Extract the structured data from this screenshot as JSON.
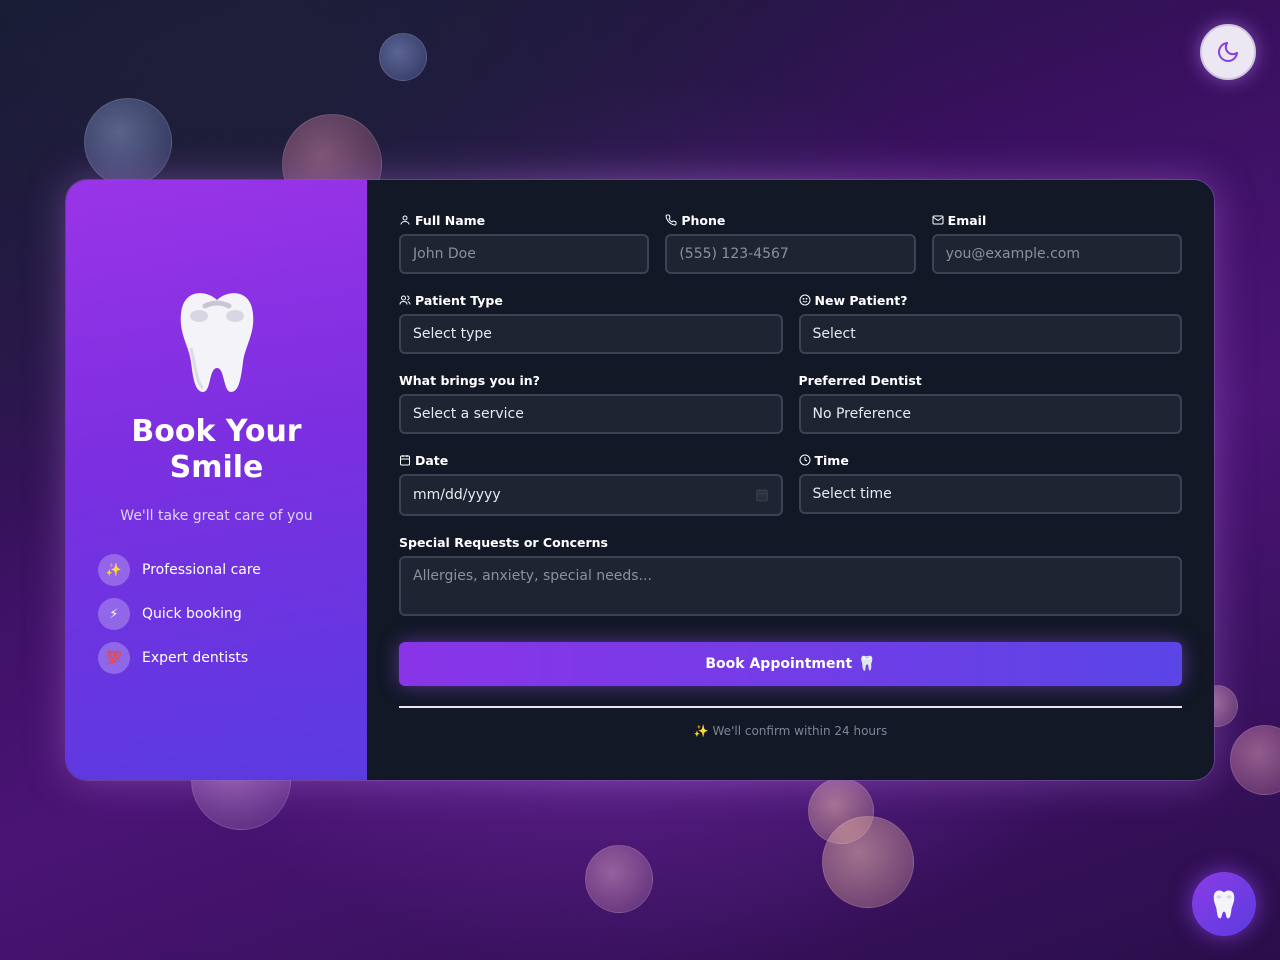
{
  "theme_toggle": {
    "icon": "moon-icon"
  },
  "sidebar": {
    "logo_icon": "tooth-icon",
    "title": "Book Your Smile",
    "subtitle": "We'll take great care of you",
    "features": [
      {
        "icon": "✨",
        "label": "Professional care"
      },
      {
        "icon": "⚡",
        "label": "Quick booking"
      },
      {
        "icon": "💯",
        "label": "Expert dentists"
      }
    ]
  },
  "form": {
    "full_name": {
      "label": "Full Name",
      "placeholder": "John Doe"
    },
    "phone": {
      "label": "Phone",
      "placeholder": "(555) 123-4567"
    },
    "email": {
      "label": "Email",
      "placeholder": "you@example.com"
    },
    "patient_type": {
      "label": "Patient Type",
      "value": "Select type"
    },
    "new_patient": {
      "label": "New Patient?",
      "value": "Select"
    },
    "service": {
      "label": "What brings you in?",
      "value": "Select a service"
    },
    "dentist": {
      "label": "Preferred Dentist",
      "value": "No Preference"
    },
    "date": {
      "label": "Date",
      "value": "mm/dd/yyyy"
    },
    "time": {
      "label": "Time",
      "value": "Select time"
    },
    "requests": {
      "label": "Special Requests or Concerns",
      "placeholder": "Allergies, anxiety, special needs..."
    },
    "submit_label": "Book Appointment",
    "submit_icon": "🦷",
    "confirm_note": "✨ We'll confirm within 24 hours"
  },
  "fab": {
    "icon": "tooth-icon"
  },
  "colors": {
    "accent_start": "#8a34e8",
    "accent_end": "#5a45e6",
    "panel_bg": "#131827",
    "input_bg": "#1f2433"
  }
}
